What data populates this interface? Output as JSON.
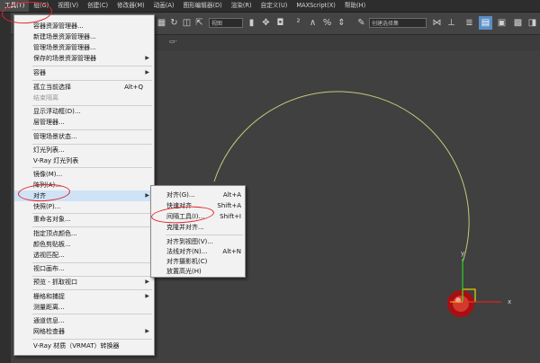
{
  "menubar": {
    "items": [
      "工具(T)",
      "组(G)",
      "视图(V)",
      "创建(C)",
      "修改器(M)",
      "动画(A)",
      "图形编辑器(D)",
      "渲染(R)",
      "自定义(U)",
      "MAXScript(X)",
      "帮助(H)"
    ]
  },
  "toolbar": {
    "view_combo": "视图",
    "selection_combo": "创建选择集"
  },
  "tools_menu": {
    "items": [
      {
        "label": "容器资源管理器...",
        "shortcut": "",
        "submenu": false,
        "disabled": false
      },
      {
        "label": "新建场景资源管理器...",
        "shortcut": "",
        "submenu": false,
        "disabled": false
      },
      {
        "label": "管理场景资源管理器...",
        "shortcut": "",
        "submenu": false,
        "disabled": false
      },
      {
        "label": "保存的场景资源管理器",
        "shortcut": "",
        "submenu": true,
        "disabled": false
      },
      {
        "label": "容器",
        "shortcut": "",
        "submenu": true,
        "disabled": false
      },
      {
        "label": "孤立当前选择",
        "shortcut": "Alt+Q",
        "submenu": false,
        "disabled": false
      },
      {
        "label": "结束隔离",
        "shortcut": "",
        "submenu": false,
        "disabled": true
      },
      {
        "label": "显示浮动框(D)...",
        "shortcut": "",
        "submenu": false,
        "disabled": false
      },
      {
        "label": "层管理器...",
        "shortcut": "",
        "submenu": false,
        "disabled": false
      },
      {
        "label": "管理场景状态...",
        "shortcut": "",
        "submenu": false,
        "disabled": false
      },
      {
        "label": "灯光列表...",
        "shortcut": "",
        "submenu": false,
        "disabled": false
      },
      {
        "label": "V-Ray 灯光列表",
        "shortcut": "",
        "submenu": false,
        "disabled": false
      },
      {
        "label": "镜像(M)...",
        "shortcut": "",
        "submenu": false,
        "disabled": false
      },
      {
        "label": "阵列(A)...",
        "shortcut": "",
        "submenu": false,
        "disabled": false
      },
      {
        "label": "对齐",
        "shortcut": "",
        "submenu": true,
        "disabled": false
      },
      {
        "label": "快照(P)...",
        "shortcut": "",
        "submenu": false,
        "disabled": false
      },
      {
        "label": "重命名对象...",
        "shortcut": "",
        "submenu": false,
        "disabled": false
      },
      {
        "label": "指定顶点颜色...",
        "shortcut": "",
        "submenu": false,
        "disabled": false
      },
      {
        "label": "颜色剪贴板...",
        "shortcut": "",
        "submenu": false,
        "disabled": false
      },
      {
        "label": "透视匹配...",
        "shortcut": "",
        "submenu": false,
        "disabled": false
      },
      {
        "label": "视口画布...",
        "shortcut": "",
        "submenu": false,
        "disabled": false
      },
      {
        "label": "预览 - 抓取视口",
        "shortcut": "",
        "submenu": true,
        "disabled": false
      },
      {
        "label": "栅格和捕捉",
        "shortcut": "",
        "submenu": true,
        "disabled": false
      },
      {
        "label": "测量距离...",
        "shortcut": "",
        "submenu": false,
        "disabled": false
      },
      {
        "label": "通道信息...",
        "shortcut": "",
        "submenu": false,
        "disabled": false
      },
      {
        "label": "网格检查器",
        "shortcut": "",
        "submenu": true,
        "disabled": false
      },
      {
        "label": "V-Ray 材质（VRMAT）转换器",
        "shortcut": "",
        "submenu": false,
        "disabled": false
      }
    ]
  },
  "align_menu": {
    "items": [
      {
        "label": "对齐(G)...",
        "shortcut": "Alt+A"
      },
      {
        "label": "快速对齐",
        "shortcut": "Shift+A"
      },
      {
        "label": "间隔工具(I)...",
        "shortcut": "Shift+I"
      },
      {
        "label": "克隆并对齐...",
        "shortcut": ""
      },
      {
        "label": "对齐到视图(V)...",
        "shortcut": ""
      },
      {
        "label": "法线对齐(N)...",
        "shortcut": "Alt+N"
      },
      {
        "label": "对齐摄影机(C)",
        "shortcut": ""
      },
      {
        "label": "放置高光(H)",
        "shortcut": ""
      }
    ]
  },
  "viewport": {
    "axis_x": "x",
    "axis_y": "y",
    "arc_color": "#c8c87a"
  }
}
